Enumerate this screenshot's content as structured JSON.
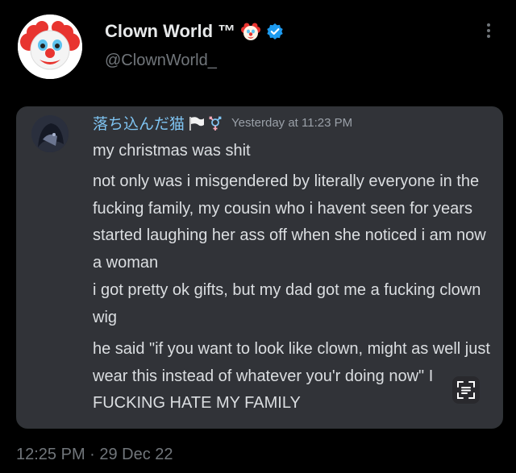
{
  "tweet": {
    "display_name": "Clown World ™",
    "handle": "@ClownWorld_",
    "timestamp": "12:25 PM · 29 Dec 22",
    "icons": {
      "avatar": "clown-face",
      "name_emoji": "clown-face-icon",
      "verified": "verified-badge-icon",
      "more": "more-options-icon"
    },
    "colors": {
      "background": "#000000",
      "verified": "#1d9bf0",
      "secondary_text": "#71767b"
    }
  },
  "embedded_message": {
    "username": "落ち込んだ猫",
    "flag_icons": [
      "white-flag-icon",
      "transgender-symbol-icon"
    ],
    "time": "Yesterday at 11:23 PM",
    "messages": [
      "my christmas was shit",
      "not only was i misgendered by literally everyone in the fucking family, my cousin who i havent seen for years started laughing her ass off when she noticed i am now a woman",
      "i got pretty ok gifts, but my dad got me a fucking clown wig",
      "he said \"if you want to look like clown, might as well just wear this instead of whatever you'r doing now\" I FUCKING HATE MY FAMILY"
    ],
    "colors": {
      "panel": "#313338",
      "username": "#7fc4f2",
      "text": "#dbdee1",
      "time": "#9aa0a8"
    }
  }
}
